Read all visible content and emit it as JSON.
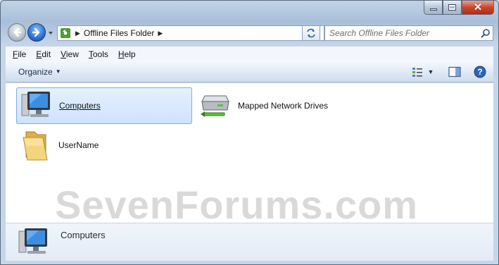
{
  "window": {
    "accent": "#a9bfd8",
    "caption_buttons": [
      "minimize-icon",
      "maximize-icon",
      "close-icon"
    ]
  },
  "navigation": {
    "back_icon": "back-arrow-icon",
    "forward_icon": "forward-arrow-icon",
    "address": {
      "root_icon": "offline-files-icon",
      "path": [
        "Offline Files Folder"
      ]
    },
    "refresh_icon": "refresh-icon",
    "search_placeholder": "Search Offline Files Folder"
  },
  "menu": [
    {
      "label": "File",
      "accel": "F",
      "rest": "ile"
    },
    {
      "label": "Edit",
      "accel": "E",
      "rest": "dit"
    },
    {
      "label": "View",
      "accel": "V",
      "rest": "iew"
    },
    {
      "label": "Tools",
      "accel": "T",
      "rest": "ools"
    },
    {
      "label": "Help",
      "accel": "H",
      "rest": "elp"
    }
  ],
  "command_bar": {
    "organize_label": "Organize",
    "view_icon": "view-options-icon",
    "preview_pane_icon": "preview-pane-icon",
    "help_icon": "help-icon"
  },
  "items": [
    {
      "label": "Computers",
      "icon": "computer-icon",
      "selected": true
    },
    {
      "label": "Mapped Network Drives",
      "icon": "network-drive-icon",
      "selected": false
    },
    {
      "label": "UserName",
      "icon": "folder-icon",
      "selected": false
    }
  ],
  "watermark": "SevenForums.com",
  "details": {
    "label": "Computers",
    "icon": "computer-icon"
  }
}
